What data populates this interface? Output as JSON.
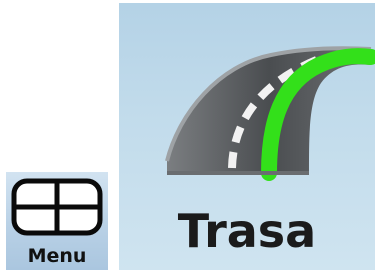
{
  "menu_button": {
    "label": "Menu",
    "icon": "window-grid-icon"
  },
  "route_button": {
    "label": "Trasa",
    "icon": "road-route-icon"
  },
  "colors": {
    "tile_blue": "#c1dbeb",
    "route_green": "#33e01a",
    "road_gray": "#5a5d60"
  }
}
